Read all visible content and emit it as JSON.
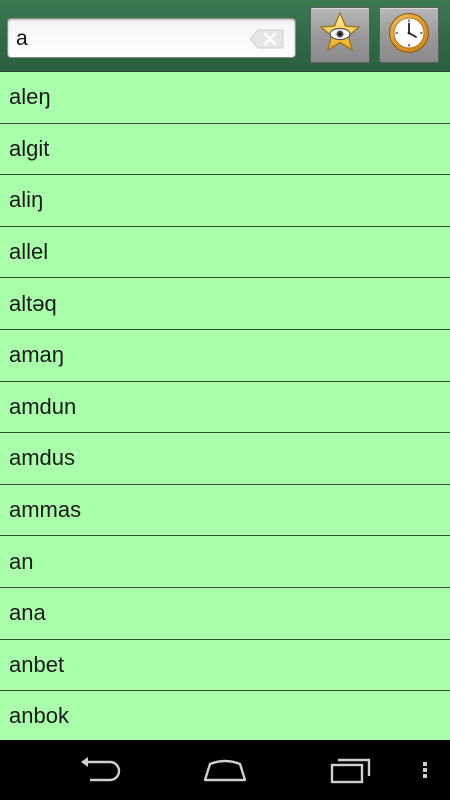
{
  "search": {
    "value": "a",
    "clear_icon": "backspace-clear-icon"
  },
  "toolbar": {
    "favorites_icon": "star-eye-icon",
    "history_icon": "clock-icon"
  },
  "words": [
    "aleŋ",
    "algit",
    "aliŋ",
    "allel",
    "altəq",
    "amaŋ",
    "amdun",
    "amdus",
    "ammas",
    "an",
    "ana",
    "anbet",
    "anbok"
  ],
  "colors": {
    "list_background": "#aaffaa",
    "topbar_background": "#2f6a45",
    "separator": "#2f4f2f"
  },
  "navbar": {
    "back_icon": "back-icon",
    "home_icon": "home-icon",
    "recent_icon": "recent-apps-icon",
    "menu_icon": "overflow-menu-icon"
  }
}
